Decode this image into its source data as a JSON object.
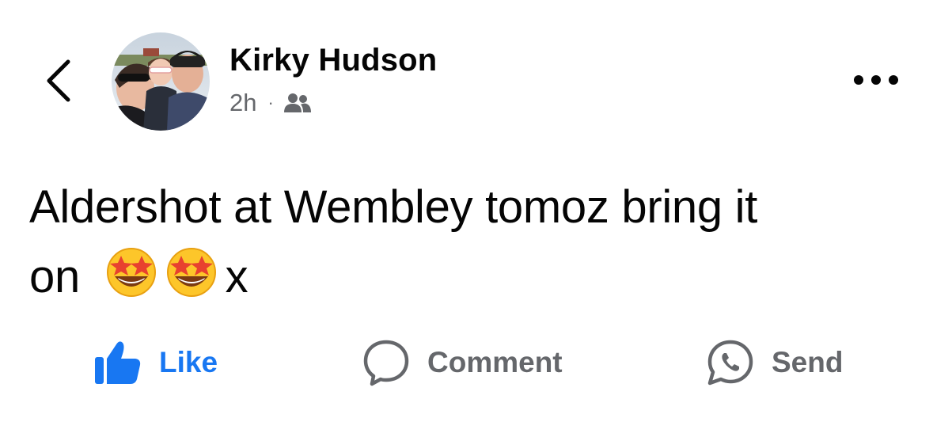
{
  "header": {
    "author_name": "Kirky Hudson",
    "timestamp": "2h",
    "separator": "·",
    "audience_icon": "friends-icon",
    "back_icon": "chevron-left-icon",
    "more_icon": "more-horizontal-icon"
  },
  "post": {
    "line1": "Aldershot at Wembley tomoz bring it",
    "line2_prefix": "on",
    "emojis": [
      "🤩",
      "🤩"
    ],
    "line2_suffix": "x"
  },
  "actions": {
    "like_label": "Like",
    "comment_label": "Comment",
    "send_label": "Send",
    "like_icon": "thumbs-up-icon",
    "comment_icon": "comment-bubble-icon",
    "send_icon": "messenger-icon"
  },
  "colors": {
    "accent": "#1877f2",
    "secondary_text": "#65676b",
    "primary_text": "#050505"
  }
}
